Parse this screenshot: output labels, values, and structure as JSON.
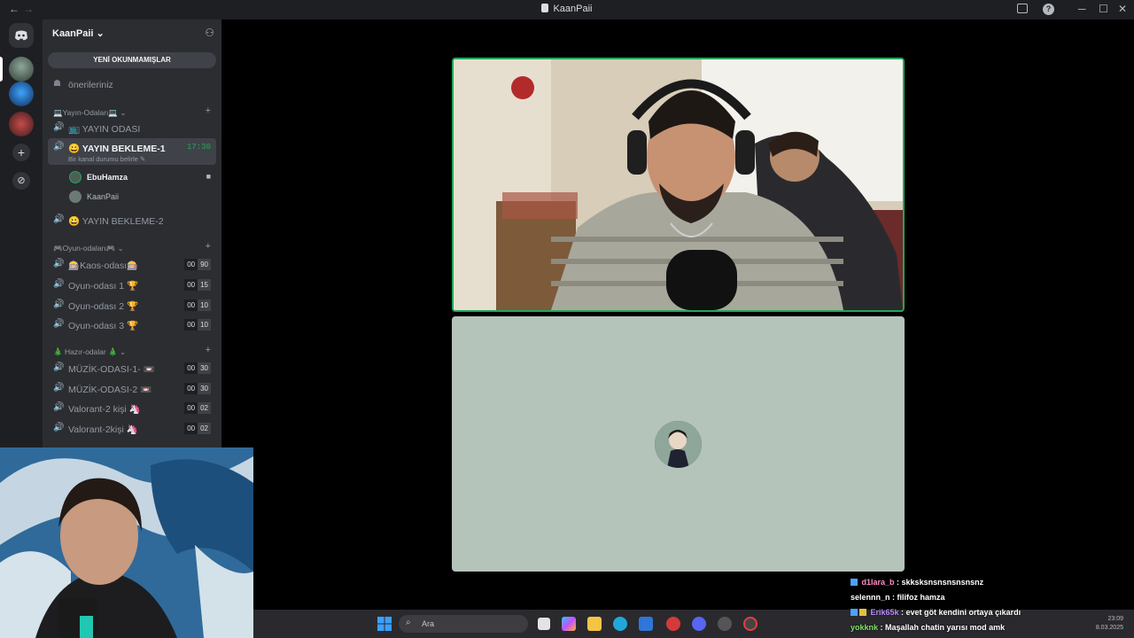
{
  "window": {
    "title": "KaanPaii",
    "back_glyph": "←",
    "forward_glyph": "→",
    "min_glyph": "─",
    "max_glyph": "☐",
    "close_glyph": "✕",
    "help_glyph": "?"
  },
  "rail": {
    "home_icon": "discord-logo-icon",
    "add_glyph": "+",
    "explore_glyph": "⊘"
  },
  "guild": {
    "name": "KaanPaii",
    "chevron": "⌄",
    "add_member_glyph": "⚇"
  },
  "sidebar": {
    "unread_label": "YENİ OKUNMAMIŞLAR",
    "suggestions_label": "önerileriniz",
    "categories": [
      {
        "label": "💻Yayın-Odaları💻 ⌄",
        "plus": "+"
      },
      {
        "label": "🎮Oyun-odaları🎮 ⌄",
        "plus": "+"
      },
      {
        "label": "🎄 Hazır-odalar 🎄 ⌄",
        "plus": "+"
      }
    ],
    "channels": [
      {
        "label": "📺 YAYIN ODASI"
      },
      {
        "label": "😀 YAYIN BEKLEME-1",
        "time": "17:30",
        "status": "Bir kanal durumu belirle ✎"
      },
      {
        "label": "😀 YAYIN BEKLEME-2"
      },
      {
        "label": "🎰Kaos-odası🎰",
        "count": "00",
        "limit": "90"
      },
      {
        "label": "Oyun-odası 1 🏆",
        "count": "00",
        "limit": "15"
      },
      {
        "label": "Oyun-odası 2 🏆",
        "count": "00",
        "limit": "10"
      },
      {
        "label": "Oyun-odası 3 🏆",
        "count": "00",
        "limit": "10"
      },
      {
        "label": "MÜZİK-ODASI-1- 📼",
        "count": "00",
        "limit": "30"
      },
      {
        "label": "MÜZİK-ODASI-2 📼",
        "count": "00",
        "limit": "30"
      },
      {
        "label": "Valorant-2 kişi 🦄",
        "count": "00",
        "limit": "02"
      },
      {
        "label": "Valorant-2kişi 🦄",
        "count": "00",
        "limit": "02"
      }
    ],
    "members": [
      {
        "name": "EbuHamza",
        "camera_icon": "■"
      },
      {
        "name": "KaanPaii"
      }
    ],
    "speaker_glyph": "🔊"
  },
  "taskbar": {
    "search_placeholder": "Ara",
    "search_glyph": "⌕",
    "time": "23:09",
    "date": "8.03.2025"
  },
  "chat": [
    {
      "user": "d1lara_b",
      "user_color": "#ff8fc7",
      "text": " : skksksnsnsnsnsnsnz",
      "badges": 1
    },
    {
      "user": "selennn_n",
      "user_color": "#ffffff",
      "text": " : filifoz hamza",
      "badges": 0
    },
    {
      "user": "Erik65k",
      "user_color": "#b98cff",
      "text": " : evet göt kendini ortaya çıkardı",
      "badges": 2
    },
    {
      "user": "yokknk",
      "user_color": "#7fe06a",
      "text": " : Maşallah chatin yarısı mod amk",
      "badges": 0
    }
  ],
  "colors": {
    "speaking_ring": "#23a55a",
    "sidebar_bg": "#2b2d31",
    "rail_bg": "#1e1f22"
  }
}
